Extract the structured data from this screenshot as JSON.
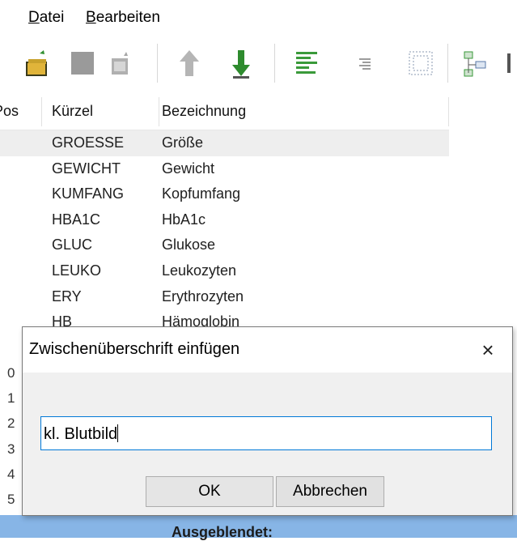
{
  "menu": {
    "file_acc": "D",
    "file_rest": "atei",
    "edit_acc": "B",
    "edit_rest": "earbeiten"
  },
  "toolbar": {
    "icons": [
      "folder-open-icon",
      "blank-gray-icon",
      "document-sparkle-icon",
      "move-up-disabled-icon",
      "move-down-icon",
      "align-left-icon",
      "align-right-icon",
      "grid-dots-icon",
      "tree-insert-icon"
    ]
  },
  "table": {
    "headers": {
      "pos": "Pos",
      "kuerzel": "Kürzel",
      "bezeichnung": "Bezeichnung"
    },
    "rows": [
      {
        "kuerzel": "GROESSE",
        "bezeichnung": "Größe"
      },
      {
        "kuerzel": "GEWICHT",
        "bezeichnung": "Gewicht"
      },
      {
        "kuerzel": "KUMFANG",
        "bezeichnung": "Kopfumfang"
      },
      {
        "kuerzel": "HBA1C",
        "bezeichnung": "HbA1c"
      },
      {
        "kuerzel": "GLUC",
        "bezeichnung": "Glukose"
      },
      {
        "kuerzel": "LEUKO",
        "bezeichnung": "Leukozyten"
      },
      {
        "kuerzel": "ERY",
        "bezeichnung": "Erythrozyten"
      },
      {
        "kuerzel": "HB",
        "bezeichnung": "Hämoglobin"
      }
    ]
  },
  "left_numbers": [
    "0",
    "1",
    "2",
    "3",
    "4",
    "5"
  ],
  "bottom": {
    "label": "Ausgeblendet:"
  },
  "dialog": {
    "title": "Zwischenüberschrift einfügen",
    "close": "×",
    "input_value": "kl. Blutbild",
    "ok_label": "OK",
    "cancel_label": "Abbrechen"
  },
  "colors": {
    "focus": "#0078d7",
    "bottom_bar": "#87b5e6",
    "selected_row": "#eeeeee"
  }
}
